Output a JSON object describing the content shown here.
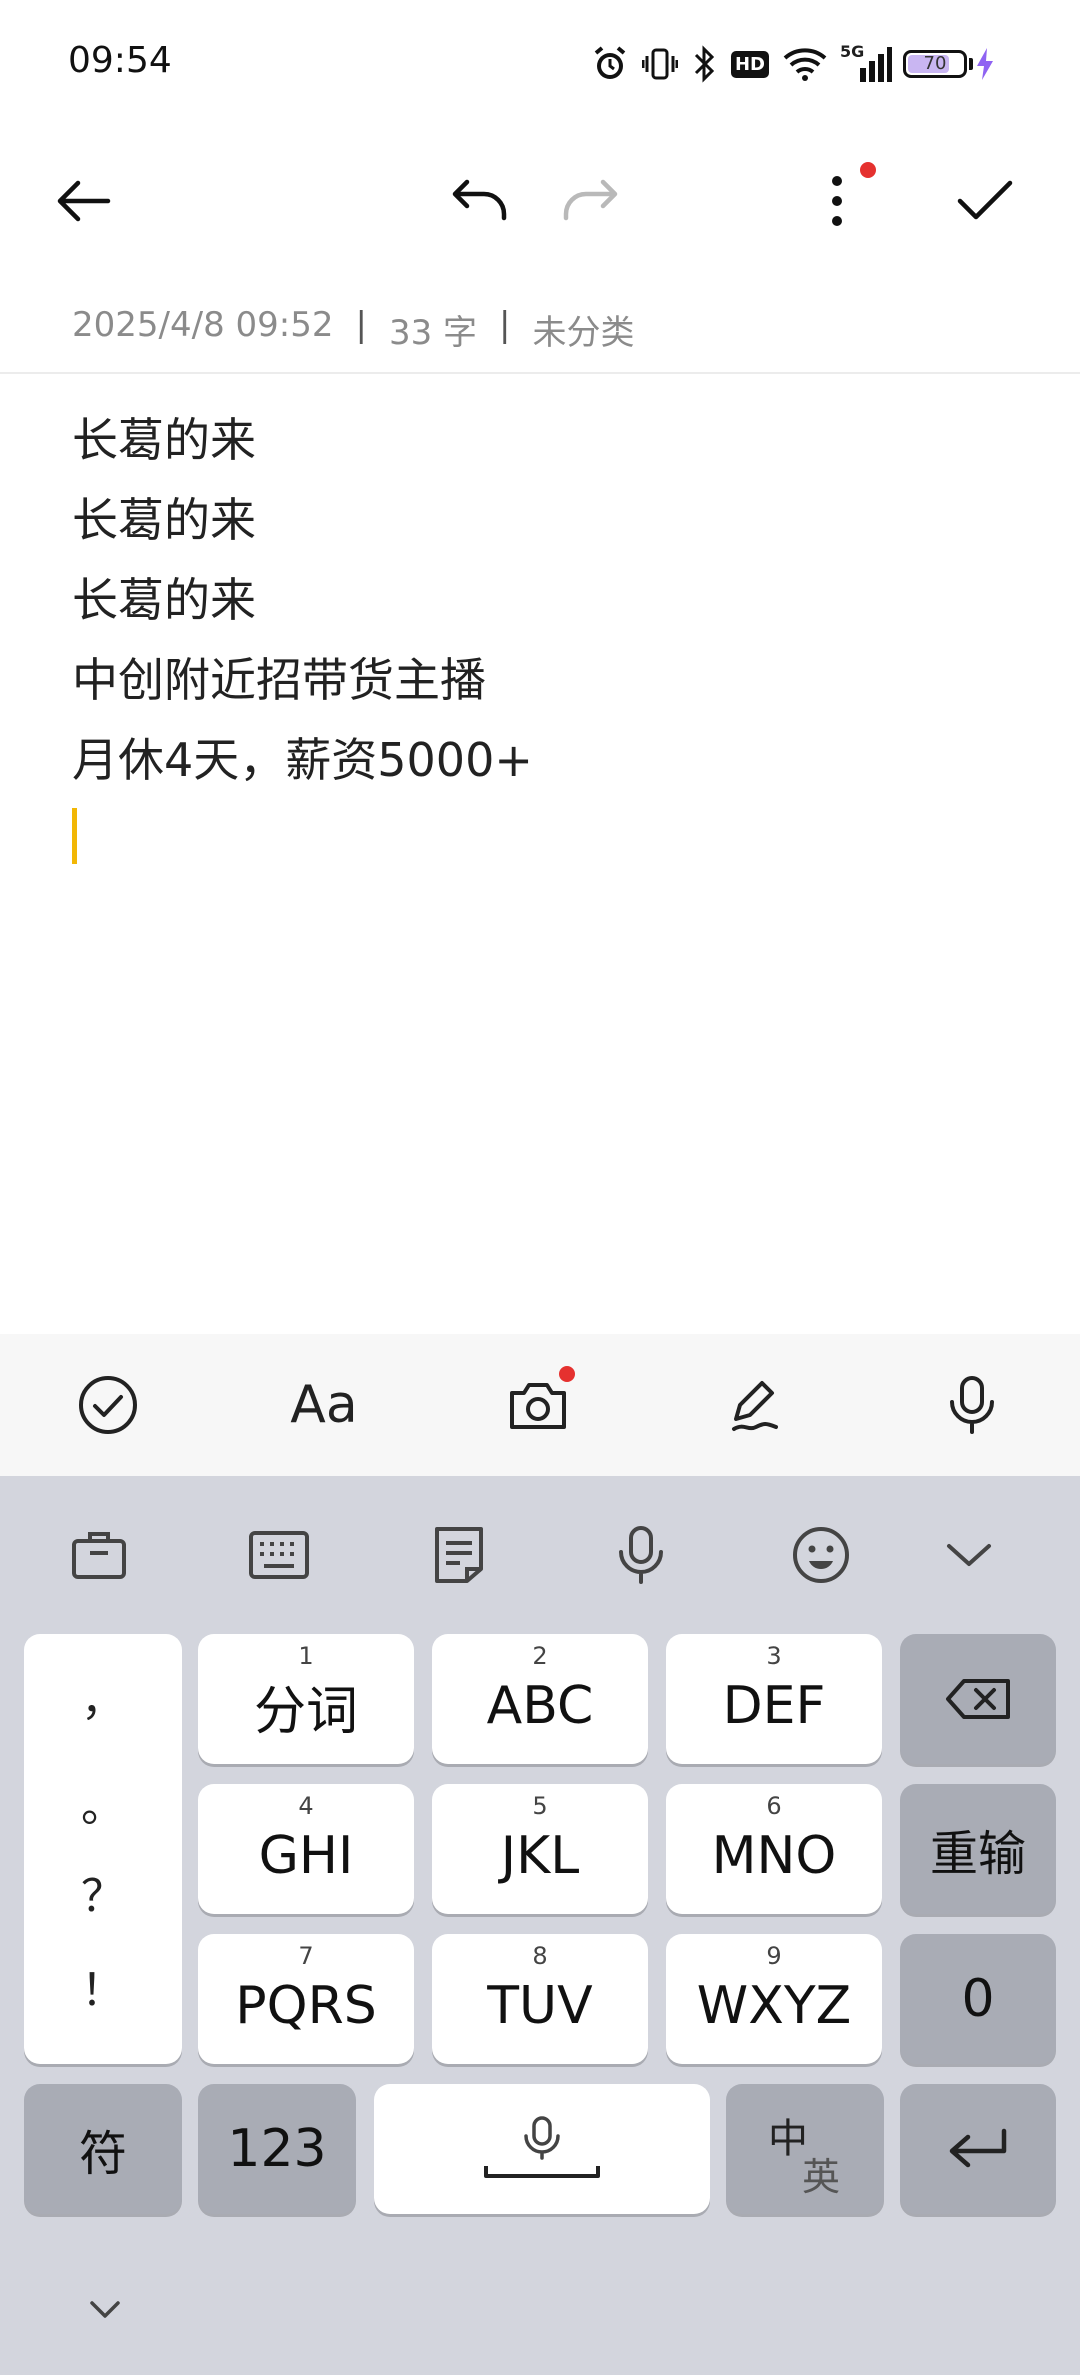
{
  "status_bar": {
    "time": "09:54",
    "icons": [
      "alarm-icon",
      "vibrate-icon",
      "bluetooth-icon",
      "hd-icon",
      "wifi-icon",
      "5g-signal-icon",
      "battery-icon",
      "charging-icon"
    ],
    "hd_label": "HD",
    "network_label": "5G",
    "battery": "70",
    "battery_color": "#c9b6f2"
  },
  "top_bar": {
    "icons": [
      "back-arrow-icon",
      "undo-icon",
      "redo-icon",
      "more-vert-icon",
      "checkmark-icon"
    ]
  },
  "meta": {
    "date": "2025/4/8 09:52",
    "separator": "|",
    "count": "33 字",
    "category": "未分类"
  },
  "note": {
    "lines": [
      "长葛的来",
      "长葛的来",
      "长葛的来",
      "中创附近招带货主播",
      "月休4天，薪资5000+"
    ]
  },
  "edit_toolbar": {
    "icons": [
      "checklist-icon",
      "text-format-icon",
      "camera-icon",
      "pen-icon",
      "microphone-icon"
    ],
    "format_label": "Aa"
  },
  "keyboard": {
    "tools": [
      "toolbox-icon",
      "keyboard-icon",
      "clipboard-icon",
      "microphone-icon",
      "emoji-icon",
      "collapse-icon"
    ],
    "punctuation": [
      "，",
      "。",
      "？",
      "！"
    ],
    "keys": [
      {
        "num": "1",
        "label": "分词"
      },
      {
        "num": "2",
        "label": "ABC"
      },
      {
        "num": "3",
        "label": "DEF"
      },
      {
        "num": "4",
        "label": "GHI"
      },
      {
        "num": "5",
        "label": "JKL"
      },
      {
        "num": "6",
        "label": "MNO"
      },
      {
        "num": "7",
        "label": "PQRS"
      },
      {
        "num": "8",
        "label": "TUV"
      },
      {
        "num": "9",
        "label": "WXYZ"
      }
    ],
    "reenter": "重输",
    "zero": "0",
    "symbol": "符",
    "numeric": "123",
    "lang_zh": "中",
    "lang_en": "英",
    "accent": "#e5312f"
  }
}
